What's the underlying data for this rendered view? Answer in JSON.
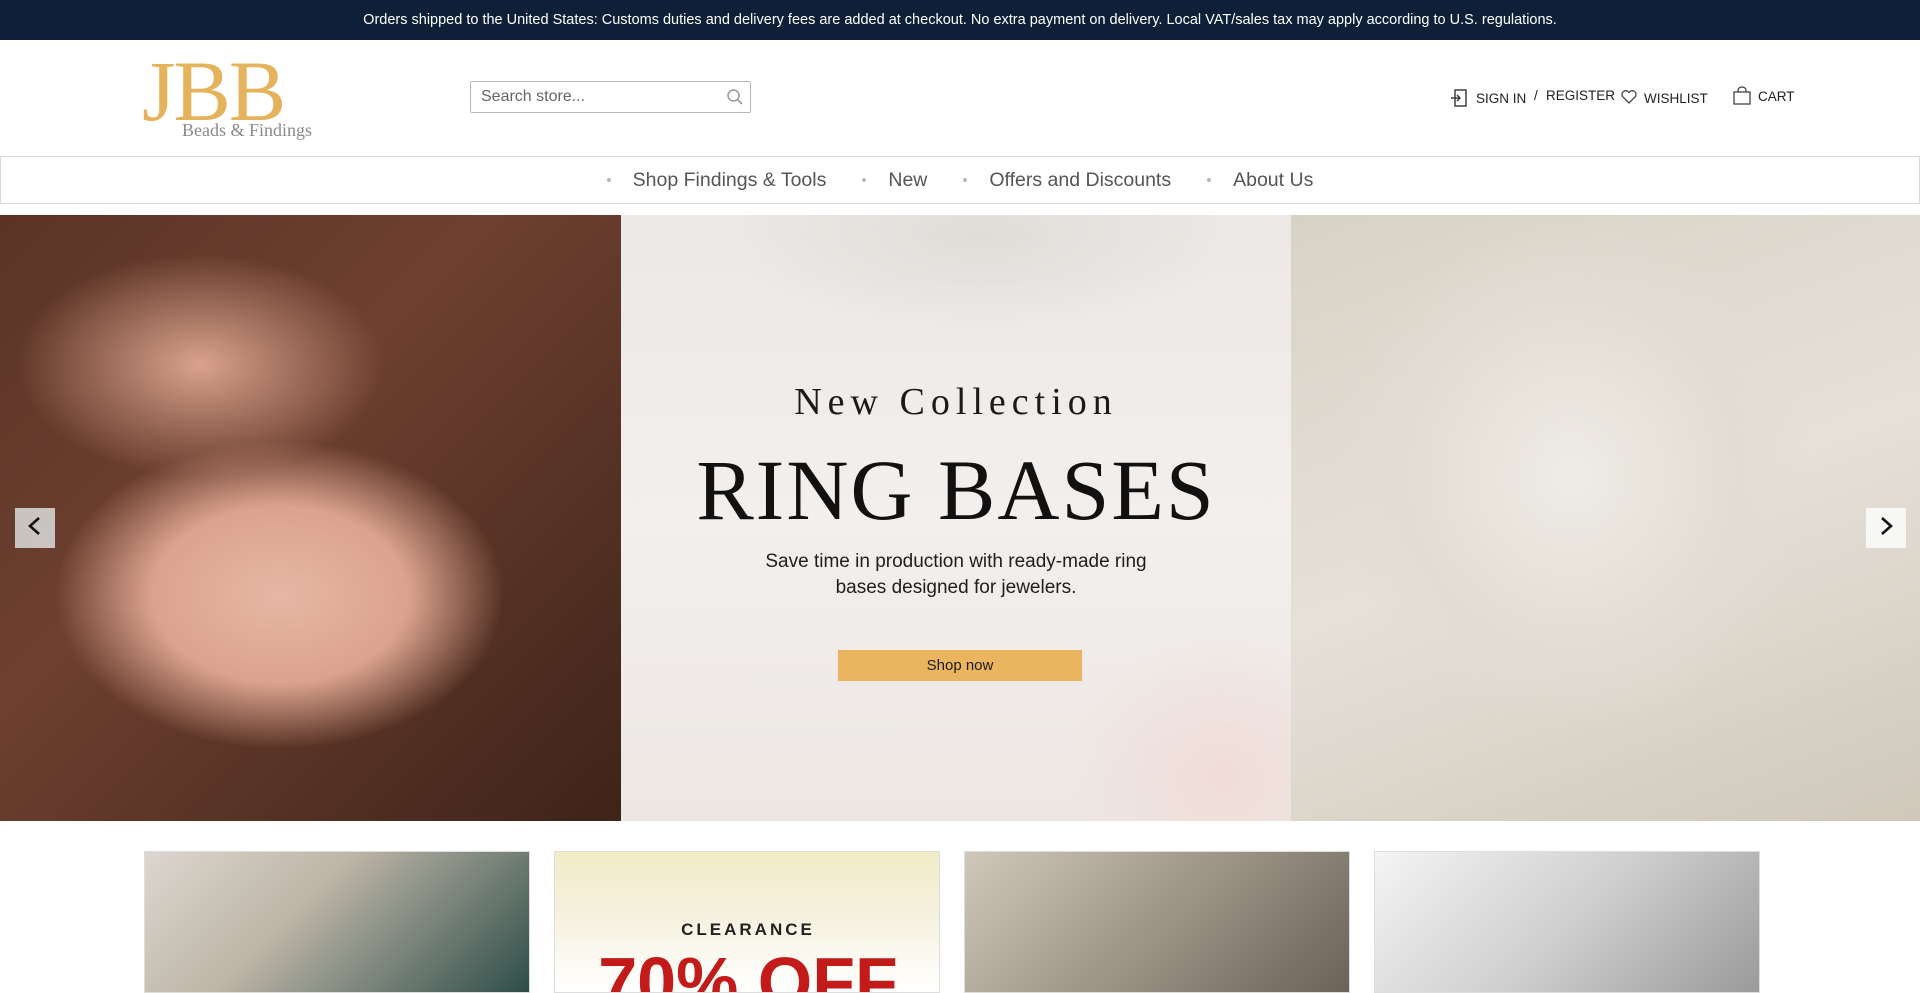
{
  "notice": "Orders shipped to the United States: Customs duties and delivery fees are added at checkout. No extra payment on delivery. Local VAT/sales tax may apply according to U.S. regulations.",
  "brand": {
    "mark": "JBB",
    "subtitle": "Beads & Findings",
    "color": "#e4b35c"
  },
  "search": {
    "placeholder": "Search store..."
  },
  "account": {
    "sign_in": "SIGN IN",
    "separator": "/",
    "register": "REGISTER",
    "wishlist": "WISHLIST",
    "cart": "CART"
  },
  "nav": {
    "items": [
      "Shop Findings & Tools",
      "New",
      "Offers and Discounts",
      "About Us"
    ]
  },
  "hero": {
    "subtitle": "New Collection",
    "title": "RING BASES",
    "description": "Save time in production with ready-made ring bases designed for jewelers.",
    "cta": "Shop now",
    "cta_color": "#eab55e"
  },
  "tiles": {
    "clearance_label": "CLEARANCE",
    "clearance_value": "70% OFF"
  },
  "colors": {
    "notice_bg": "#0d2038",
    "accent": "#e4b35c",
    "sale_red": "#c31a1a"
  }
}
